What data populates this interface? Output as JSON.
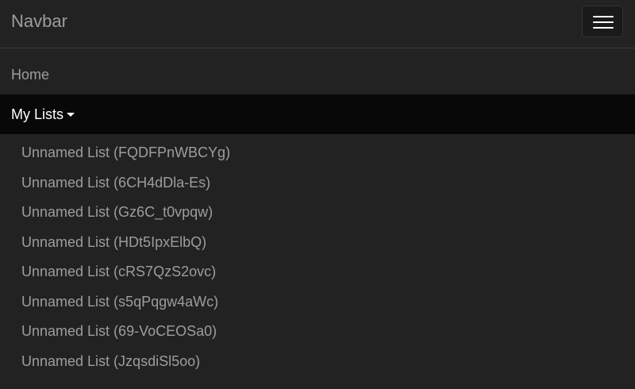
{
  "navbar": {
    "brand": "Navbar",
    "toggle_icon": "hamburger-menu-icon"
  },
  "nav": {
    "home_label": "Home",
    "my_lists_label": "My Lists",
    "my_lists_caret_icon": "caret-down-icon"
  },
  "lists": [
    "Unnamed List (FQDFPnWBCYg)",
    "Unnamed List (6CH4dDla-Es)",
    "Unnamed List (Gz6C_t0vpqw)",
    "Unnamed List (HDt5IpxElbQ)",
    "Unnamed List (cRS7QzS2ovc)",
    "Unnamed List (s5qPqgw4aWc)",
    "Unnamed List (69-VoCEOSa0)",
    "Unnamed List (JzqsdiSl5oo)"
  ],
  "colors": {
    "background": "#222222",
    "active_background": "#080808",
    "text_muted": "#9d9d9d",
    "text_active": "#ffffff"
  }
}
